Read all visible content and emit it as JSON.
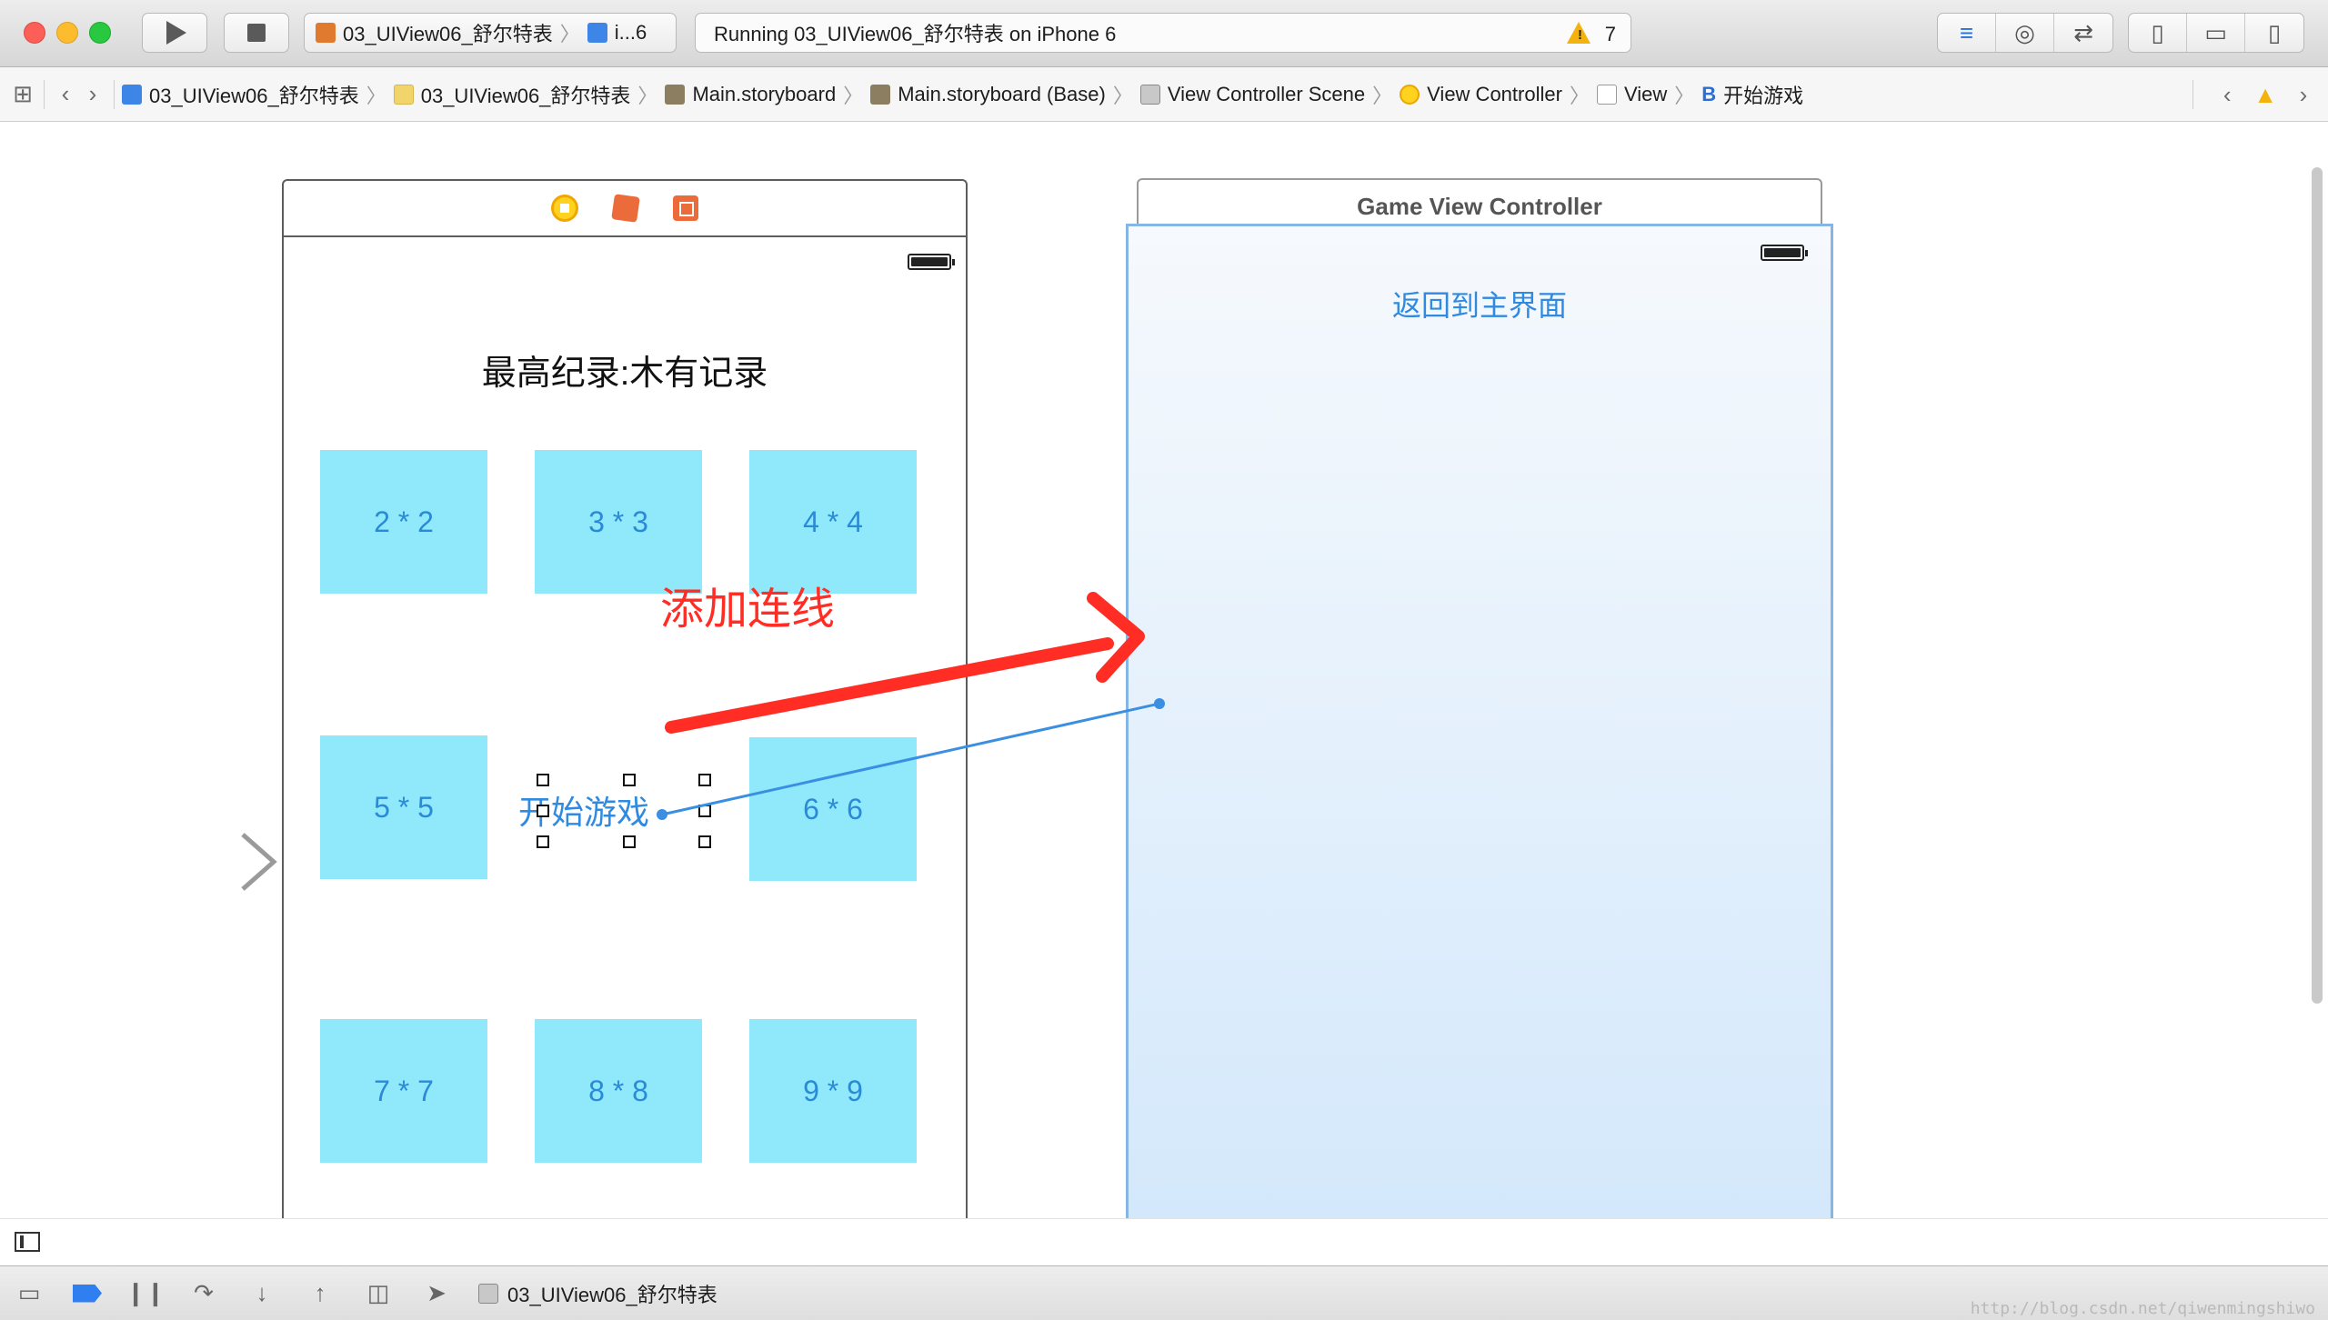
{
  "toolbar": {
    "scheme_label": "03_UIView06_舒尔特表",
    "device_label": "i...6",
    "status_text": "Running 03_UIView06_舒尔特表 on iPhone 6",
    "warning_count": "7"
  },
  "jumpbar": {
    "crumbs": [
      {
        "label": "03_UIView06_舒尔特表",
        "icon": "project-icon"
      },
      {
        "label": "03_UIView06_舒尔特表",
        "icon": "folder-icon"
      },
      {
        "label": "Main.storyboard",
        "icon": "storyboard-icon"
      },
      {
        "label": "Main.storyboard (Base)",
        "icon": "storyboard-icon"
      },
      {
        "label": "View Controller Scene",
        "icon": "scene-icon"
      },
      {
        "label": "View Controller",
        "icon": "view-controller-icon"
      },
      {
        "label": "View",
        "icon": "view-icon"
      },
      {
        "label": "开始游戏",
        "icon": "button-icon",
        "icon_glyph": "B"
      }
    ]
  },
  "scene1": {
    "best_record_label": "最高纪录:木有记录",
    "tiles": [
      "2 * 2",
      "3 * 3",
      "4 * 4",
      "5 * 5",
      "6 * 6",
      "7 * 7",
      "8 * 8",
      "9 * 9"
    ],
    "start_button_label": "开始游戏"
  },
  "scene2": {
    "title": "Game View Controller",
    "back_button_label": "返回到主界面"
  },
  "annotation": {
    "label": "添加连线",
    "color": "#ff2d24"
  },
  "debugbar": {
    "target_label": "03_UIView06_舒尔特表"
  },
  "watermark": "http://blog.csdn.net/qiwenmingshiwo",
  "colors": {
    "tile_fill": "#8fe9fa",
    "link_blue": "#2f8ae0",
    "connection_line": "#3a8fe3"
  }
}
